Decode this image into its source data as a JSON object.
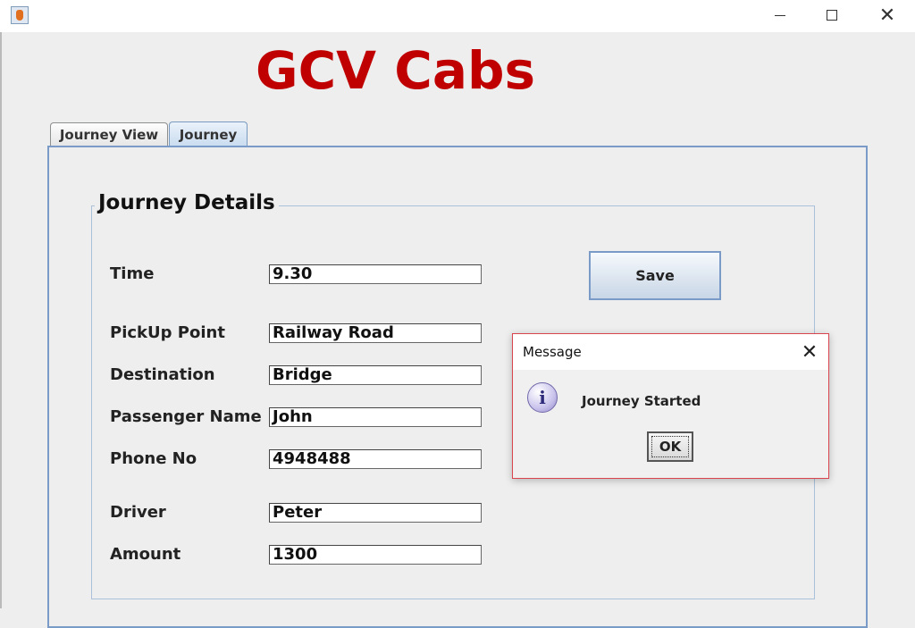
{
  "window": {
    "app_icon": "java-cup-icon",
    "minimize_icon": "minimize-icon",
    "maximize_icon": "maximize-icon",
    "close_icon": "close-icon",
    "close_glyph": "✕"
  },
  "app_title": "GCV Cabs",
  "tabs": [
    {
      "label": "Journey View",
      "selected": false
    },
    {
      "label": "Journey",
      "selected": true
    }
  ],
  "journey_details": {
    "title": "Journey Details",
    "fields": {
      "time": {
        "label": "Time",
        "value": "9.30"
      },
      "pickup": {
        "label": "PickUp Point",
        "value": "Railway Road"
      },
      "destination": {
        "label": "Destination",
        "value": "Bridge"
      },
      "passenger": {
        "label": "Passenger Name",
        "value": "John"
      },
      "phone": {
        "label": "Phone No",
        "value": "4948488"
      },
      "driver": {
        "label": "Driver",
        "value": "Peter"
      },
      "amount": {
        "label": "Amount",
        "value": "1300"
      }
    },
    "save_label": "Save"
  },
  "dialog": {
    "title": "Message",
    "close_glyph": "✕",
    "icon": "info-icon",
    "icon_glyph": "i",
    "message": "Journey Started",
    "ok_label": "OK"
  },
  "colors": {
    "title_red": "#c00000",
    "tab_selected": "#c9dcef",
    "panel_border": "#7a9bc8",
    "dialog_border": "#d9444f"
  }
}
